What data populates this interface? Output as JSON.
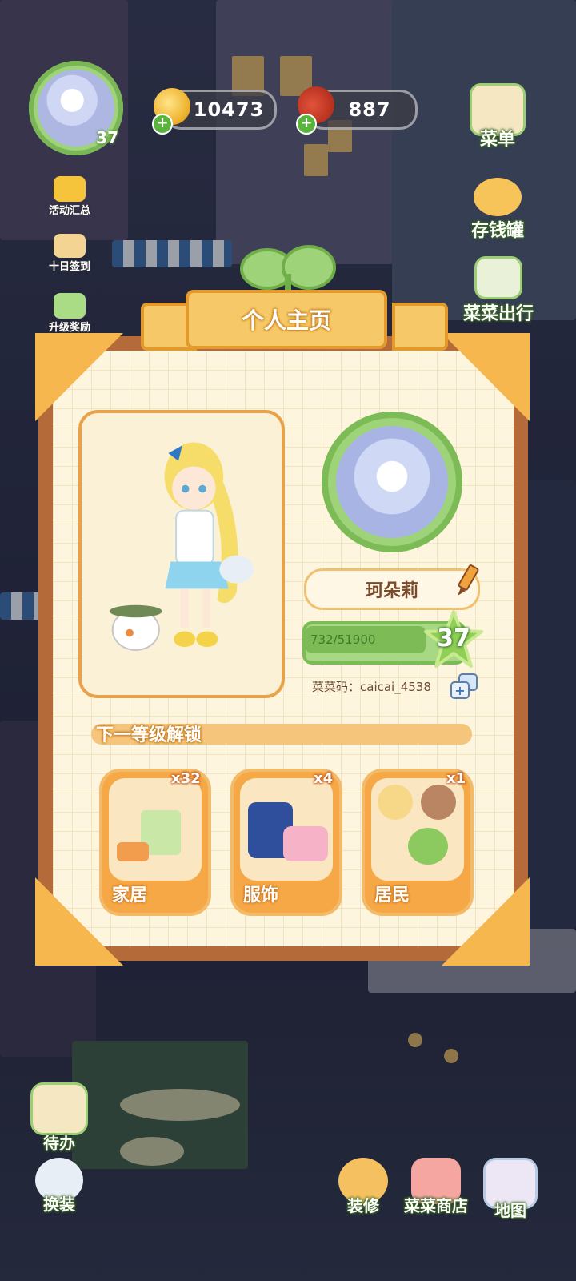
{
  "hud": {
    "avatar_level": "37",
    "coins": "10473",
    "vegetables": "887",
    "menu_label": "菜单",
    "piggy_bank_label": "存钱罐",
    "veggie_trip_label": "菜菜出行",
    "events_label": "活动汇总",
    "checkin_label": "十日签到",
    "levelup_reward_label": "升级奖励"
  },
  "panel": {
    "title": "个人主页",
    "player_name": "珂朵莉",
    "exp_text": "732/51900",
    "exp_progress": 0.0141,
    "level": "37",
    "code_text": "菜菜码：caicai_4538",
    "next_unlock_title": "下一等级解锁",
    "rewards": [
      {
        "label": "家居",
        "count": "x32"
      },
      {
        "label": "服饰",
        "count": "x4"
      },
      {
        "label": "居民",
        "count": "x1"
      }
    ]
  },
  "bottom": {
    "todo_label": "待办",
    "dressup_label": "换装",
    "decorate_label": "装修",
    "shop_label": "菜菜商店",
    "map_label": "地图"
  },
  "colors": {
    "panel_frame": "#b56a3a",
    "panel_bg": "#fdf5dd",
    "accent_green": "#7dbb57",
    "accent_orange": "#f6a847"
  }
}
